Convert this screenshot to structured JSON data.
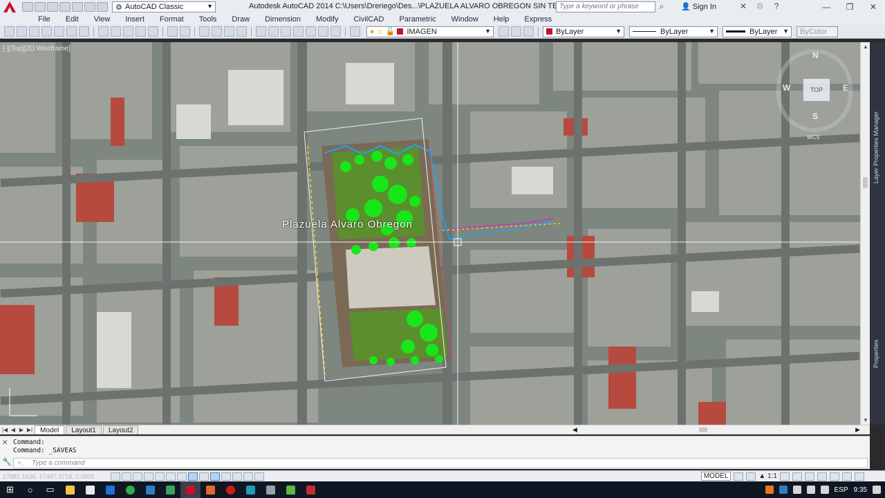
{
  "title_bar": {
    "app_icon": "autocad-a-icon",
    "workspace": "AutoCAD Classic",
    "title": "Autodesk AutoCAD 2014    C:\\Users\\Dreriego\\Des...\\PLAZUELA ALVARO OBREGON SIN TEXTOS.dwg",
    "search_placeholder": "Type a keyword or phrase",
    "sign_in": "Sign In",
    "window_controls": [
      "minimize",
      "restore",
      "close"
    ]
  },
  "menu": [
    "File",
    "Edit",
    "View",
    "Insert",
    "Format",
    "Tools",
    "Draw",
    "Dimension",
    "Modify",
    "CivilCAD",
    "Parametric",
    "Window",
    "Help",
    "Express"
  ],
  "toolbar": {
    "layer": "IMAGEN",
    "layer_color": "#c8102e",
    "color": "ByLayer",
    "linetype": "ByLayer",
    "lineweight": "ByLayer",
    "plotstyle": "ByColor"
  },
  "viewport": {
    "label": "[-][Top][2D Wireframe]",
    "map_label": "Plazuela Alvaro Obregon",
    "viewcube": {
      "top": "TOP",
      "n": "N",
      "s": "S",
      "e": "E",
      "w": "W",
      "wcs": "WCS"
    }
  },
  "palette": {
    "layer_properties": "Layer Properties Manager",
    "properties": "Properties"
  },
  "layout_tabs": [
    "Model",
    "Layout1",
    "Layout2"
  ],
  "command": {
    "history": [
      "Command:",
      "Command:  _SAVEAS"
    ],
    "placeholder": "Type a command"
  },
  "status": {
    "coords": "27882.1636, 17497.3718, 0.0000",
    "mode": "MODEL",
    "scale": "1:1"
  },
  "taskbar": {
    "lang": "ESP",
    "time": "9:35"
  }
}
